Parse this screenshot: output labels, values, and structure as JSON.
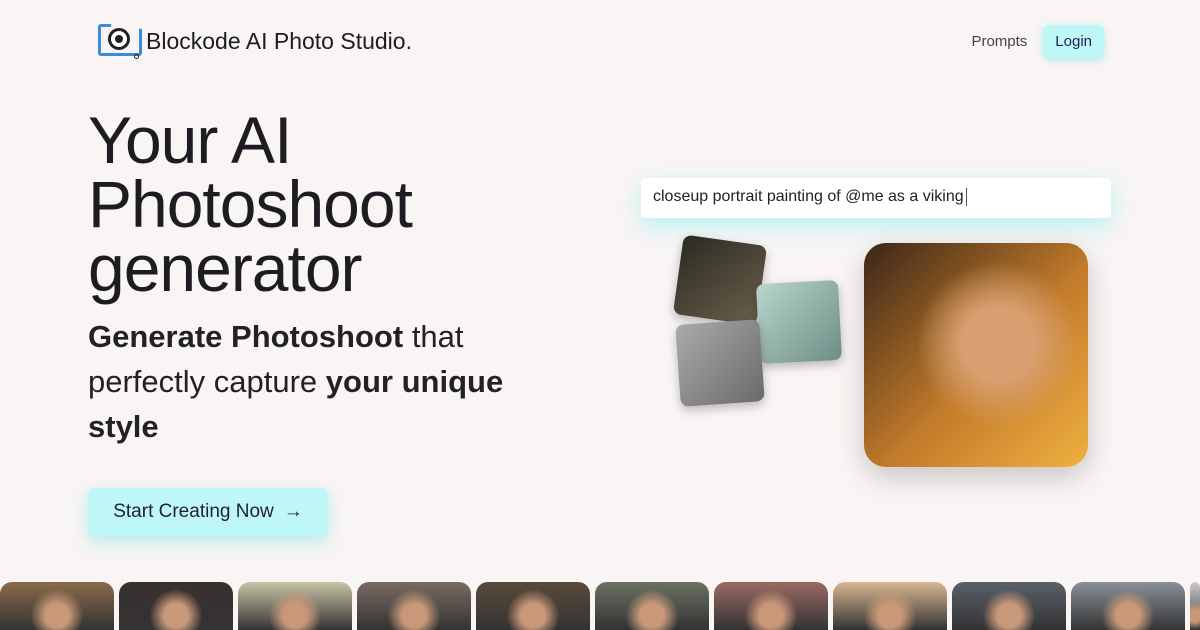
{
  "header": {
    "brand": "Blockode AI Photo Studio.",
    "nav": {
      "prompts": "Prompts",
      "login": "Login"
    }
  },
  "hero": {
    "title": "Your AI Photoshoot generator",
    "subtitle": {
      "p1": "Generate Photoshoot",
      "p2": " that perfectly capture ",
      "p3": "your unique style"
    },
    "cta": "Start Creating Now",
    "cta_icon": "arrow-right-icon"
  },
  "demo": {
    "prompt": "closeup portrait painting of @me as a viking"
  },
  "gallery": {
    "thumb_colors": [
      "#8a6a4a",
      "#3a3030",
      "#c9c4a8",
      "#7a6a62",
      "#5a4a3a",
      "#6a7062",
      "#9a6a62",
      "#d8b890",
      "#5a6068",
      "#8a9098",
      "#cccccc"
    ]
  }
}
